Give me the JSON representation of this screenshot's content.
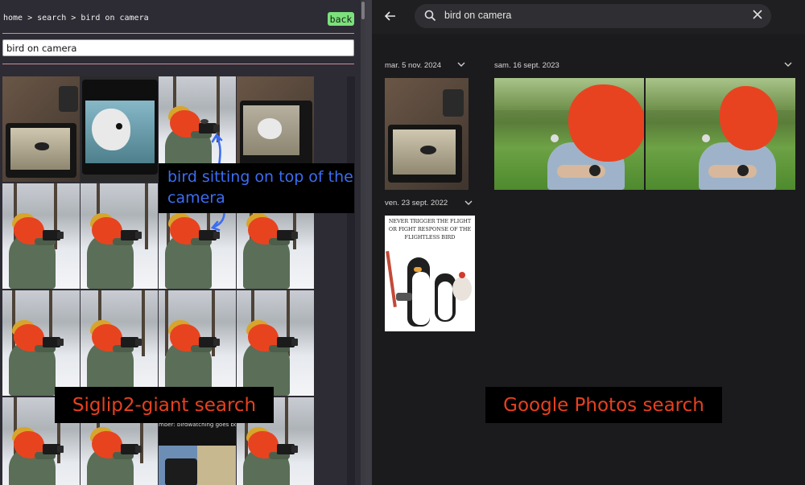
{
  "left_app": {
    "breadcrumb": "home > search > bird on camera",
    "back_label": "back",
    "search_value": "bird on camera",
    "overlay_text": "mber: birdwatching goes bo"
  },
  "annotations": {
    "bird_note": "bird sitting on top of the camera",
    "siglip_label": "Siglip2-giant search",
    "google_label": "Google Photos search"
  },
  "right_app": {
    "search_value": "bird on camera",
    "date_groups": [
      {
        "label": "mar. 5 nov. 2024"
      },
      {
        "label": "sam. 16 sept. 2023"
      },
      {
        "label": "ven. 23 sept. 2022"
      }
    ],
    "meme_text": "Never trigger the flight or fight response of the flightless bird"
  },
  "colors": {
    "accent_back": "#7ce07c",
    "annotation_blue": "#3b6df3",
    "annotation_red": "#e6411f",
    "censor_blob": "#e8431f"
  },
  "icons": [
    "search-icon",
    "back-arrow-icon",
    "close-icon",
    "chevron-down-icon",
    "arrow-icon"
  ]
}
